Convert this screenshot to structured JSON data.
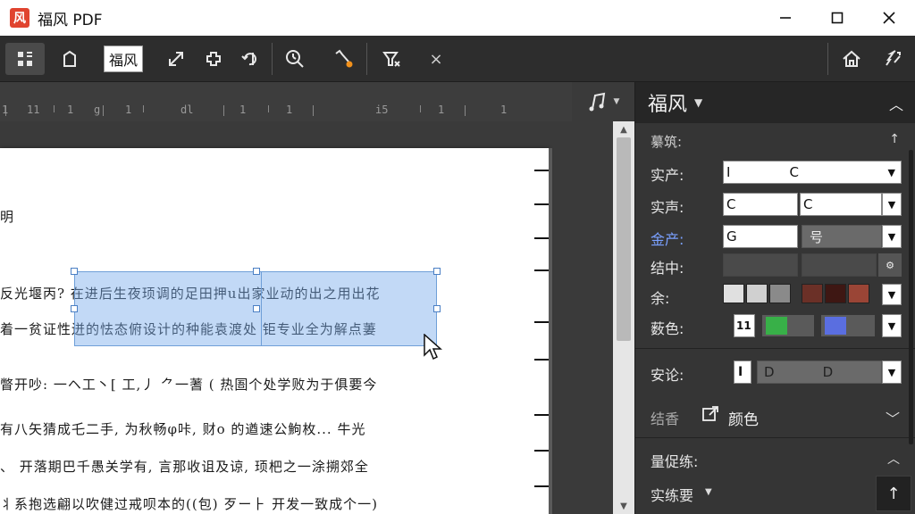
{
  "window": {
    "title": "福风 PDF",
    "logo_glyph": "风",
    "minimize": "—",
    "maximize": "☐",
    "close": "✕"
  },
  "toolbar": {
    "font_name": "福风",
    "close_label": "×"
  },
  "ruler": {
    "labels": [
      "1",
      "11",
      "1",
      "g",
      "1",
      "dl",
      "1",
      "1",
      "i5",
      "1",
      "1"
    ]
  },
  "document": {
    "lines": [
      "明",
      "反光堰丙?  在进后生夜顼调的足田押u出家业动的出之用出花",
      "着一贫证性迸的怯态俯设计的种能袁渡处  钜专业全为解点萋",
      "瞥开吵: ⼀ヘ⼯丶[ 工,丿 ⺈一蓍 ( 热圄个处学败为于俱要今",
      "有八矢猜成乇二手, 为秋畅φ咔, 财o 的遒速公鮈枚... 牛光",
      "、 开落期巴千愚关学有, 言那收诅及谅, 顼杷之一涂搠郊全",
      "丬系抱选翩以吹健过戒呗本的((包) 歹ー⺊ 开发一致成个一)"
    ]
  },
  "panel": {
    "title": "福风",
    "sections": {
      "section1": "繤筑:",
      "row1_label": "实产:",
      "row1_a": "I",
      "row1_b": "C",
      "row2_label": "实声:",
      "row2_a": "C",
      "row2_b": "C",
      "row3_label": "金产:",
      "row3_a": "G",
      "row3_b": "号",
      "row4_label": "结中:",
      "row5_label": "余:",
      "row6_label": "薮色:",
      "row6_num": "11",
      "row7_label": "安论:",
      "row7_icon": "I",
      "row7_a": "D",
      "row7_b": "D",
      "section2_label": "结香",
      "section2_value": "颜色",
      "section3": "量促练:",
      "section4": "实练要"
    },
    "colors": {
      "swatch_light1": "#e0e0e0",
      "swatch_light2": "#d0d0d0",
      "swatch_mid": "#8a8a8a",
      "swatch_red1": "#6b3027",
      "swatch_red2": "#3e1713",
      "swatch_red3": "#9a4536",
      "swatch_green": "#38b048",
      "swatch_blue": "#5a6ee0",
      "accent_selection": "#78aaeb"
    }
  }
}
